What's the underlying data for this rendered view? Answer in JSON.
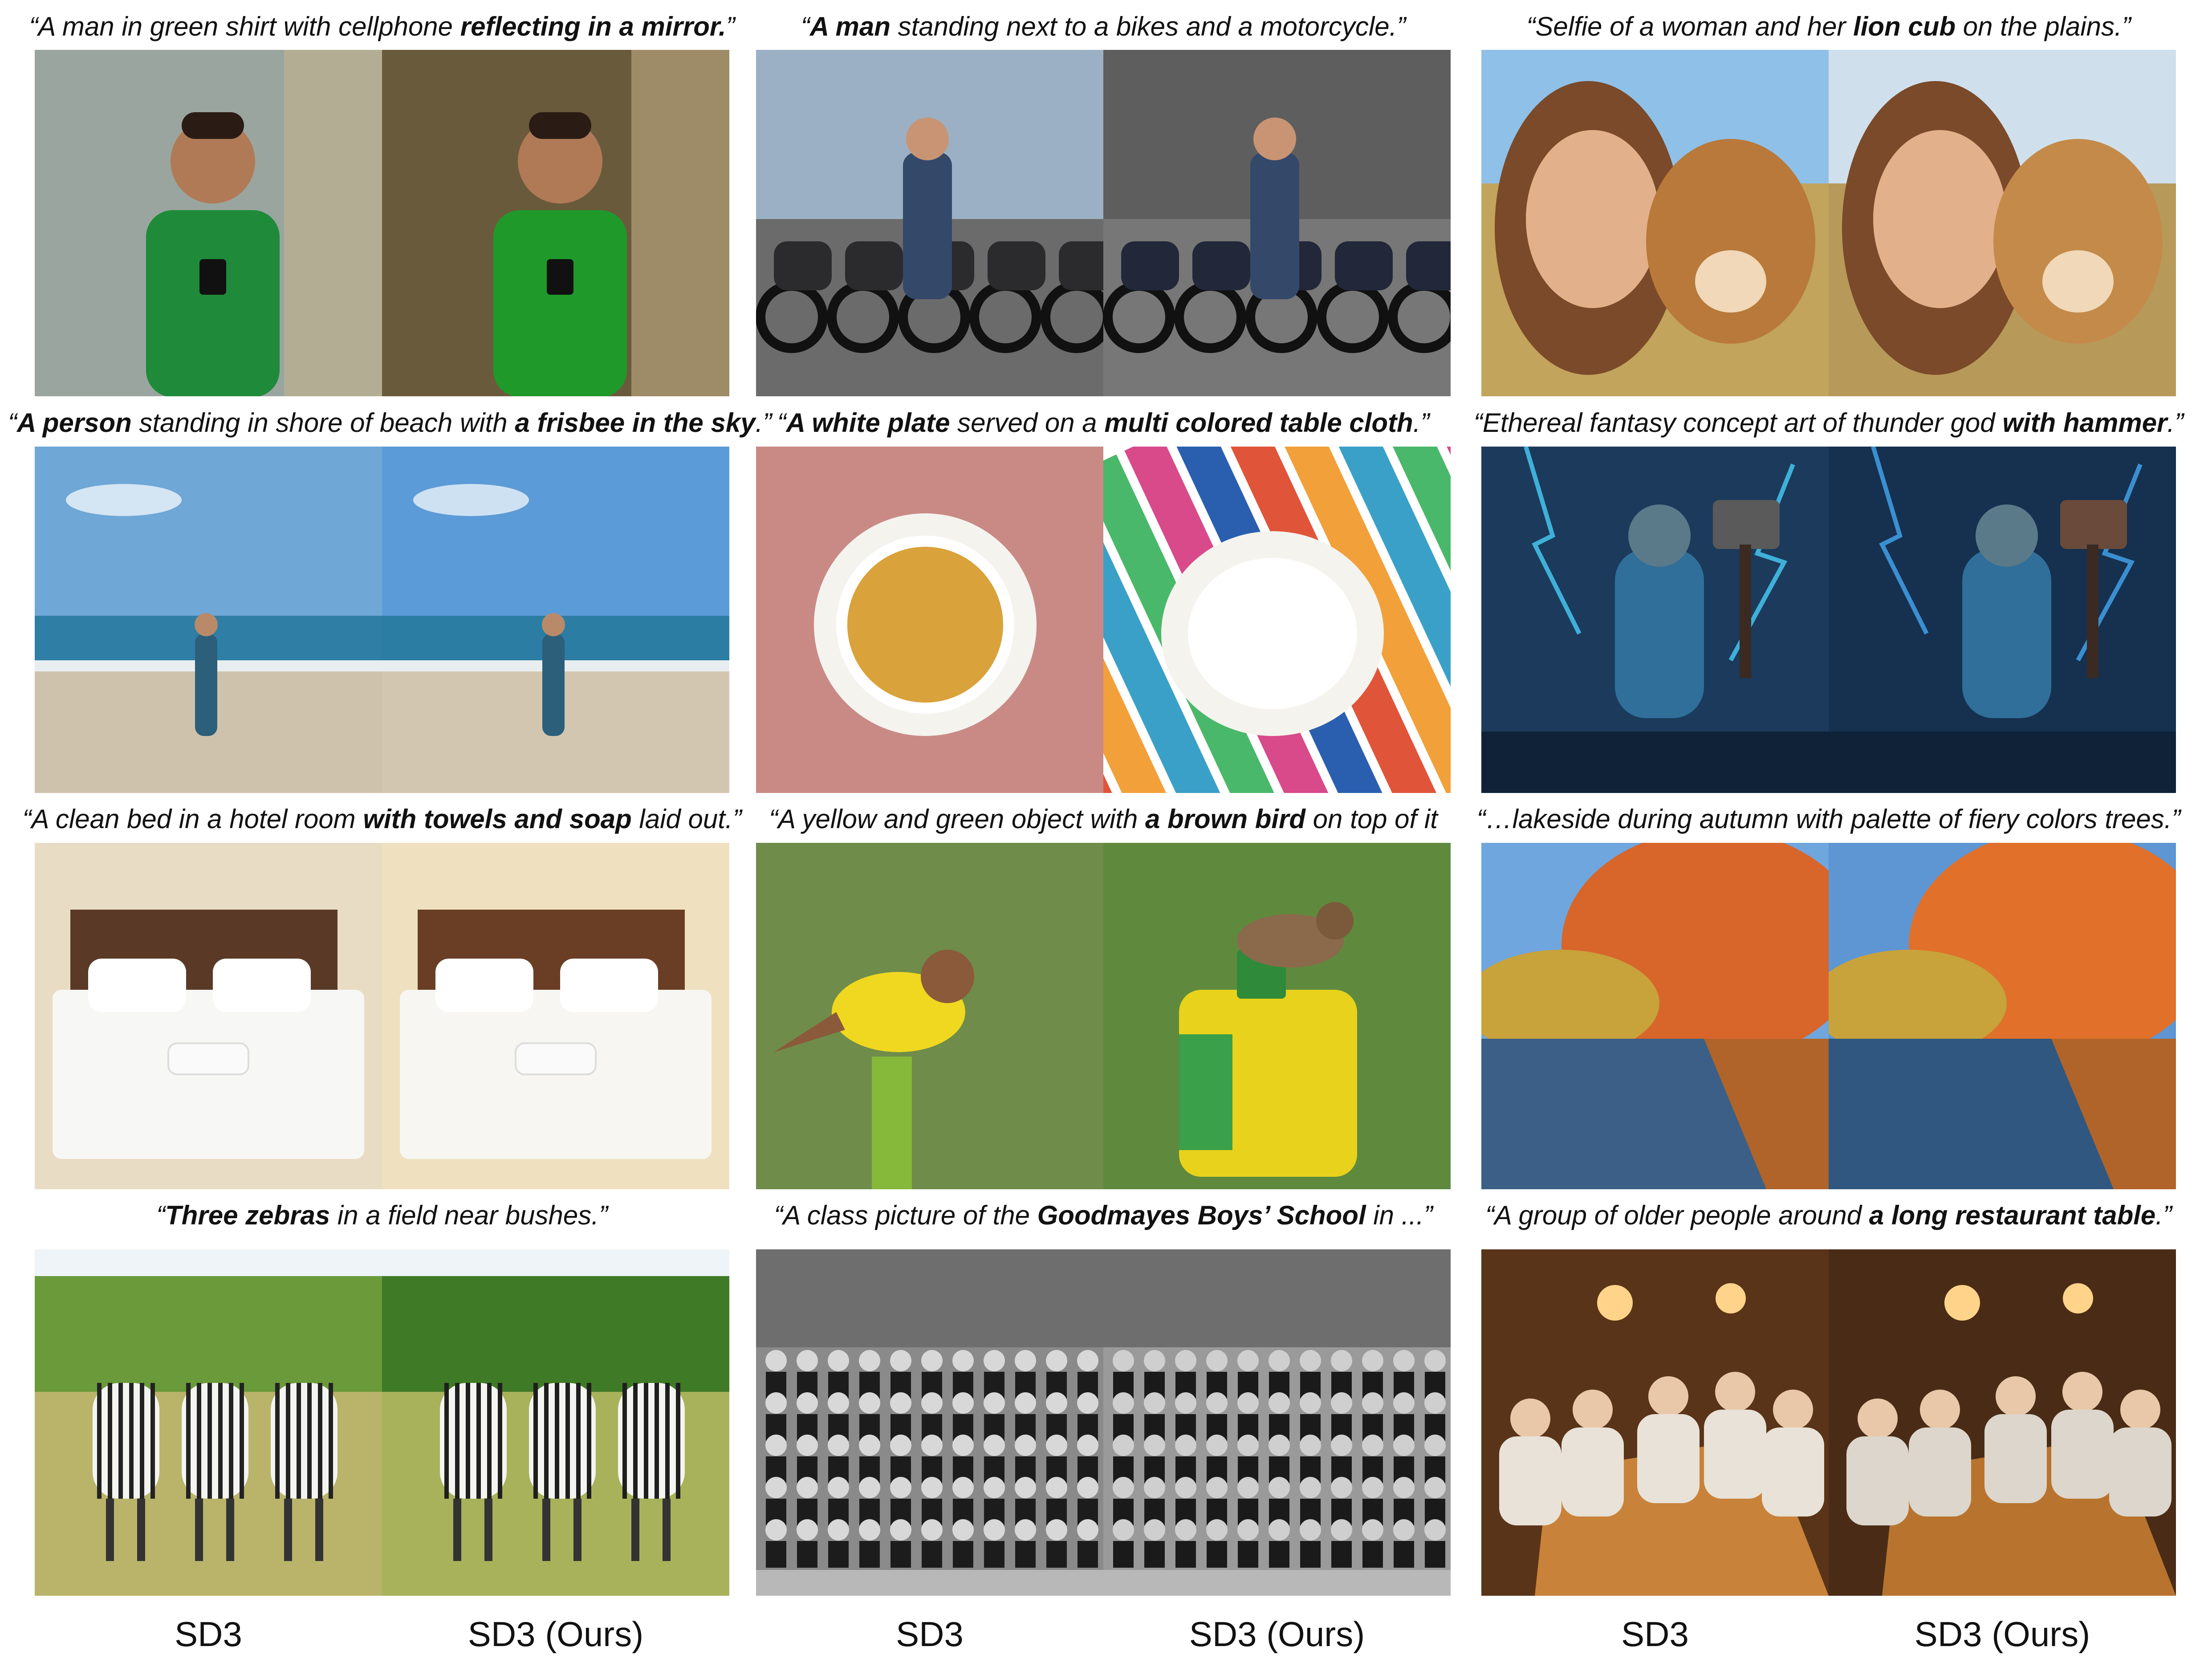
{
  "panels": [
    {
      "caption": [
        {
          "t": "“A man in green shirt with cellphone ",
          "b": false
        },
        {
          "t": "reflecting in a mirror.",
          "b": true
        },
        {
          "t": "”",
          "b": false
        }
      ],
      "left": {
        "scene": "mirror-selfie-man",
        "colors": [
          "#9aa59f",
          "#1f8a3a",
          "#c8b58a"
        ]
      },
      "right": {
        "scene": "mirror-selfie-man",
        "colors": [
          "#6a5a3c",
          "#1f9a2a",
          "#c9b48a"
        ]
      }
    },
    {
      "caption": [
        {
          "t": "“",
          "b": false
        },
        {
          "t": "A man",
          "b": true
        },
        {
          "t": " standing next to a bikes and a motorcycle.”",
          "b": false
        }
      ],
      "left": {
        "scene": "motorcycles",
        "colors": [
          "#9bb0c4",
          "#2b2b2e",
          "#6b6b6b"
        ]
      },
      "right": {
        "scene": "motorcycles",
        "colors": [
          "#5e5e5e",
          "#22283a",
          "#777777"
        ]
      }
    },
    {
      "caption": [
        {
          "t": "“Selfie of a woman and her ",
          "b": false
        },
        {
          "t": "lion cub",
          "b": true
        },
        {
          "t": " on the plains.”",
          "b": false
        }
      ],
      "left": {
        "scene": "woman-lion-selfie",
        "colors": [
          "#8fc0e8",
          "#c2a45c",
          "#b8793a"
        ]
      },
      "right": {
        "scene": "woman-lion-selfie",
        "colors": [
          "#cfe0ec",
          "#b79a5a",
          "#c48a4a"
        ]
      }
    },
    {
      "caption": [
        {
          "t": "“",
          "b": false
        },
        {
          "t": "A person",
          "b": true
        },
        {
          "t": " standing in shore of beach with ",
          "b": false
        },
        {
          "t": "a frisbee in the sky",
          "b": true
        },
        {
          "t": ".”",
          "b": false
        }
      ],
      "left": {
        "scene": "beach",
        "colors": [
          "#6fa7d6",
          "#2f7ea6",
          "#cfc2ad"
        ]
      },
      "right": {
        "scene": "beach",
        "colors": [
          "#5b9bd7",
          "#2c7da3",
          "#d3c6b0"
        ]
      }
    },
    {
      "caption": [
        {
          "t": "“",
          "b": false
        },
        {
          "t": "A white plate",
          "b": true
        },
        {
          "t": " served on a ",
          "b": false
        },
        {
          "t": "multi colored table cloth",
          "b": true
        },
        {
          "t": ".”",
          "b": false
        }
      ],
      "left": {
        "scene": "plate",
        "colors": [
          "#c98a86",
          "#f5f3ee",
          "#d9a23a"
        ]
      },
      "right": {
        "scene": "plate-stripes",
        "colors": [
          "#e0553a",
          "#f5f3ee",
          "#3aa0c8"
        ]
      }
    },
    {
      "caption": [
        {
          "t": "“Ethereal fantasy concept art of thunder god ",
          "b": false
        },
        {
          "t": "with hammer",
          "b": true
        },
        {
          "t": ".”",
          "b": false
        }
      ],
      "left": {
        "scene": "thunder-god",
        "colors": [
          "#1b3a5c",
          "#3fb0d8",
          "#5a5a5a"
        ]
      },
      "right": {
        "scene": "thunder-god",
        "colors": [
          "#16304f",
          "#3a8fd0",
          "#6a4a3a"
        ]
      }
    },
    {
      "caption": [
        {
          "t": "“A clean bed in a hotel room ",
          "b": false
        },
        {
          "t": "with towels and soap",
          "b": true
        },
        {
          "t": " laid out.”",
          "b": false
        }
      ],
      "left": {
        "scene": "hotel-bed",
        "colors": [
          "#e9dcc4",
          "#f7f7f5",
          "#5a3a26"
        ]
      },
      "right": {
        "scene": "hotel-bed",
        "colors": [
          "#efe1bf",
          "#f7f6f2",
          "#6a3e24"
        ]
      }
    },
    {
      "caption": [
        {
          "t": "“A yellow and green object with ",
          "b": false
        },
        {
          "t": "a brown bird",
          "b": true
        },
        {
          "t": " on top of it",
          "b": false
        }
      ],
      "left": {
        "scene": "bird-post",
        "colors": [
          "#6f8c4a",
          "#f0d820",
          "#8a5a3a"
        ]
      },
      "right": {
        "scene": "bird-box",
        "colors": [
          "#5f8a3e",
          "#e8d21c",
          "#8a6a4a"
        ]
      }
    },
    {
      "caption": [
        {
          "t": "“…lakeside during autumn with palette of fiery colors trees.”",
          "b": false
        }
      ],
      "left": {
        "scene": "autumn-lake",
        "colors": [
          "#6fa6de",
          "#d8652a",
          "#3b5f86"
        ]
      },
      "right": {
        "scene": "autumn-lake",
        "colors": [
          "#5e96d4",
          "#e0702a",
          "#2f5780"
        ]
      }
    },
    {
      "caption": [
        {
          "t": "“",
          "b": false
        },
        {
          "t": "Three zebras",
          "b": true
        },
        {
          "t": " in a field near bushes.”",
          "b": false
        }
      ],
      "left": {
        "scene": "zebras",
        "colors": [
          "#6a9a3a",
          "#b9b46a",
          "#222222"
        ]
      },
      "right": {
        "scene": "zebras",
        "colors": [
          "#3f7a26",
          "#a8b25a",
          "#1e1e1e"
        ]
      }
    },
    {
      "caption": [
        {
          "t": "“A class picture of the ",
          "b": false
        },
        {
          "t": "Goodmayes Boys’ School",
          "b": true
        },
        {
          "t": " in ...”",
          "b": false
        }
      ],
      "left": {
        "scene": "class-photo",
        "colors": [
          "#8a8a8a",
          "#1c1c1c",
          "#d8d8d8"
        ]
      },
      "right": {
        "scene": "class-photo",
        "colors": [
          "#9a9a9a",
          "#1a1a1a",
          "#cfcfcf"
        ]
      }
    },
    {
      "caption": [
        {
          "t": "“A group of older people around ",
          "b": false
        },
        {
          "t": "a long restaurant table",
          "b": true
        },
        {
          "t": ".”",
          "b": false
        }
      ],
      "left": {
        "scene": "restaurant",
        "colors": [
          "#5a3418",
          "#c8823a",
          "#e8e2d8"
        ]
      },
      "right": {
        "scene": "restaurant",
        "colors": [
          "#4a2c16",
          "#b8742e",
          "#dcd6cc"
        ]
      }
    }
  ],
  "footer_labels": [
    "SD3",
    "SD3 (Ours)",
    "SD3",
    "SD3 (Ours)",
    "SD3",
    "SD3 (Ours)"
  ]
}
